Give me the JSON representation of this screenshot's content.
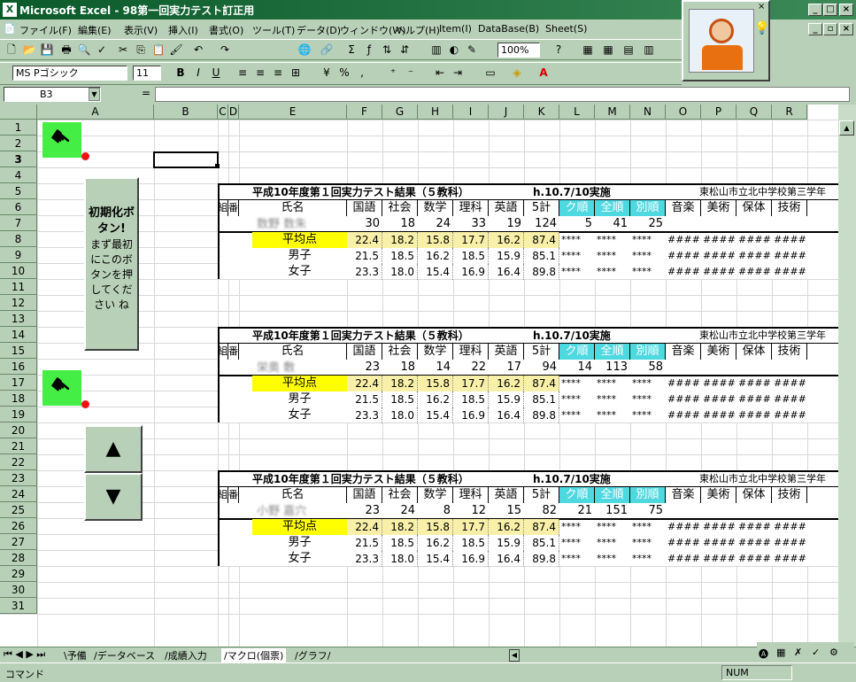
{
  "window": {
    "title": "Microsoft Excel - 98第一回実力テスト訂正用"
  },
  "menu": [
    "ファイル(F)",
    "編集(E)",
    "表示(V)",
    "挿入(I)",
    "書式(O)",
    "ツール(T)",
    "データ(D)",
    "ウィンドウ(W)",
    "ヘルプ(H)",
    "Item(I)",
    "DataBase(B)",
    "Sheet(S)"
  ],
  "toolbar": {
    "zoom": "100%",
    "font": "MS Pゴシック",
    "size": "11"
  },
  "formula": {
    "namebox": "B3",
    "eq": "="
  },
  "columns": [
    "A",
    "B",
    "C",
    "D",
    "E",
    "F",
    "G",
    "H",
    "I",
    "J",
    "K",
    "L",
    "M",
    "N",
    "O",
    "P",
    "Q",
    "R"
  ],
  "rows": [
    "1",
    "2",
    "3",
    "4",
    "5",
    "6",
    "7",
    "8",
    "9",
    "10",
    "11",
    "12",
    "13",
    "14",
    "15",
    "16",
    "17",
    "18",
    "19",
    "20",
    "21",
    "22",
    "23",
    "24",
    "25",
    "26",
    "27",
    "28",
    "29",
    "30",
    "31"
  ],
  "init_button": {
    "title": "初期化ボタン!",
    "body": "まず最初にこのボタンを押してください ね"
  },
  "table_common": {
    "title": "平成10年度第１回実力テスト結果（５教科）",
    "date": "h.10.7/10実施",
    "school": "東松山市立北中学校第三学年",
    "headers": [
      "組",
      "番",
      "氏名",
      "国語",
      "社会",
      "数学",
      "理科",
      "英語",
      "5計",
      "ク順",
      "全順",
      "別順",
      "音楽",
      "美術",
      "保体",
      "技術"
    ],
    "avg_label": "平均点",
    "male_label": "男子",
    "female_label": "女子",
    "avg": [
      "22.4",
      "18.2",
      "15.8",
      "17.7",
      "16.2",
      "87.4"
    ],
    "male": [
      "21.5",
      "18.5",
      "16.2",
      "18.5",
      "15.9",
      "85.1"
    ],
    "female": [
      "23.3",
      "18.0",
      "15.4",
      "16.9",
      "16.4",
      "89.8"
    ],
    "stars": "****",
    "hashes": "####"
  },
  "tables": [
    {
      "name_blur": "数野 数朱",
      "scores": [
        "30",
        "18",
        "24",
        "33",
        "19",
        "124",
        "5",
        "41",
        "25"
      ]
    },
    {
      "name_blur": "栄奥 敷",
      "scores": [
        "23",
        "18",
        "14",
        "22",
        "17",
        "94",
        "14",
        "113",
        "58"
      ]
    },
    {
      "name_blur": "小野 嘉穴",
      "scores": [
        "23",
        "24",
        "8",
        "12",
        "15",
        "82",
        "21",
        "151",
        "75"
      ]
    }
  ],
  "sheet_tabs": [
    "予備",
    "データベース",
    "成績入力",
    "マクロ(個票)",
    "グラフ"
  ],
  "status": {
    "left": "コマンド",
    "num": "NUM"
  },
  "nav_buttons": {
    "up": "▲",
    "down": "▼"
  }
}
